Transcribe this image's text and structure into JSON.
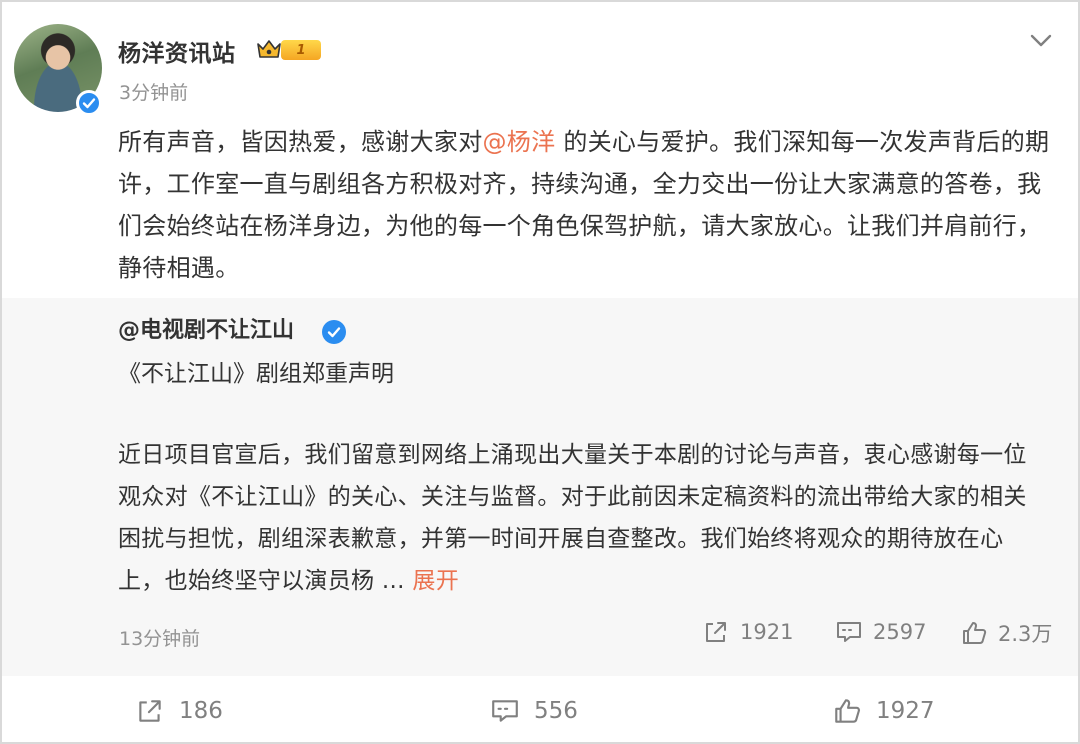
{
  "post": {
    "author": "杨洋资讯站",
    "level": "1",
    "time": "3分钟前",
    "text_before": "所有声音，皆因热爱，感谢大家对",
    "mention": "@杨洋",
    "text_after": " 的关心与爱护。我们深知每一次发声背后的期许，工作室一直与剧组各方积极对齐，持续沟通，全力交出一份让大家满意的答卷，我们会始终站在杨洋身边，为他的每一个角色保驾护航，请大家放心。让我们并肩前行，静待相遇。"
  },
  "repost": {
    "author": "@电视剧不让江山",
    "title": "《不让江山》剧组郑重声明",
    "body": "近日项目官宣后，我们留意到网络上涌现出大量关于本剧的讨论与声音，衷心感谢每一位观众对《不让江山》的关心、关注与监督。对于此前因未定稿资料的流出带给大家的相关困扰与担忧，剧组深表歉意，并第一时间开展自查整改。我们始终将观众的期待放在心上，也始终坚守以演员杨 ",
    "ellipsis": "...",
    "expand_label": "展开",
    "time": "13分钟前",
    "reposts": "1921",
    "comments": "2597",
    "likes": "2.3万"
  },
  "actions": {
    "reposts": "186",
    "comments": "556",
    "likes": "1927"
  },
  "icons": {
    "header": [
      "crown-icon",
      "verified-icon",
      "chevron-down-icon"
    ],
    "stats": [
      "share-icon",
      "comment-icon",
      "like-icon"
    ]
  },
  "colors": {
    "accent": "#eb7350",
    "verified": "#2b8df0",
    "repost_bg": "#f7f7f7",
    "muted": "#939393"
  }
}
